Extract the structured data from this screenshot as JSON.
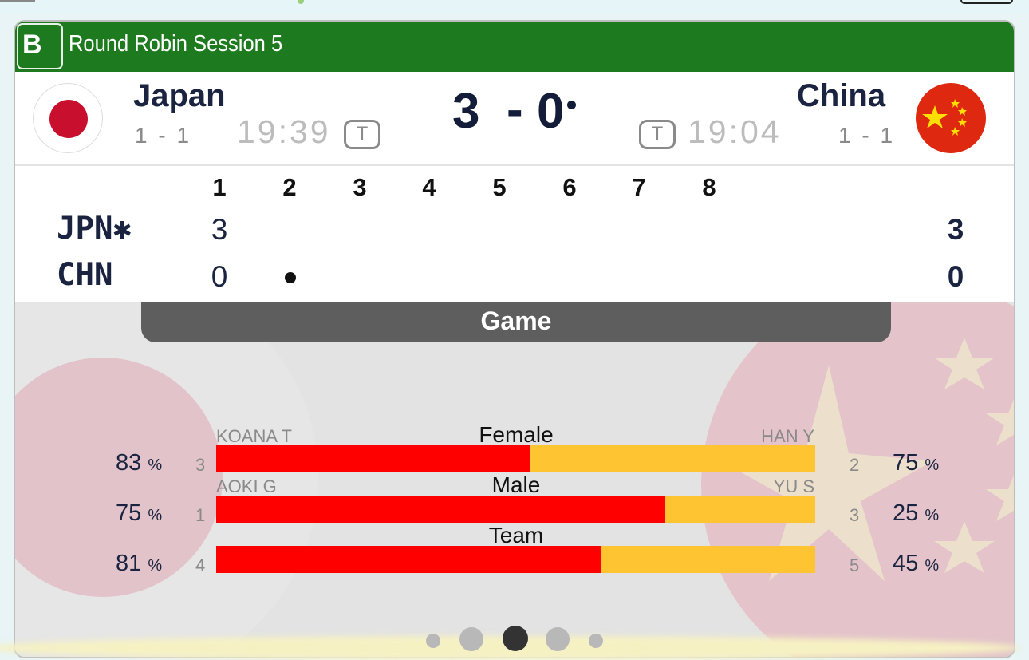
{
  "header": {
    "badge": "B",
    "session_title": "Round Robin Session 5"
  },
  "home": {
    "name": "Japan",
    "abbr": "JPN",
    "hammer_mark": "✱",
    "record": "1 - 1",
    "clock": "19:39",
    "timeout_label": "T",
    "score": "3",
    "flag": "japan-flag-icon"
  },
  "away": {
    "name": "China",
    "abbr": "CHN",
    "record": "1 - 1",
    "clock": "19:04",
    "timeout_label": "T",
    "score": "0",
    "flag": "china-flag-icon"
  },
  "score_separator": "-",
  "linescore": {
    "ends": [
      "1",
      "2",
      "3",
      "4",
      "5",
      "6",
      "7",
      "8"
    ],
    "home_ends": [
      "3"
    ],
    "away_ends": [
      "0"
    ],
    "home_total": "3",
    "away_total": "0"
  },
  "stats": {
    "tab_label": "Game",
    "rows": [
      {
        "label": "Female",
        "home_player": "KOANA T",
        "away_player": "HAN Y",
        "home_count": "3",
        "away_count": "2",
        "home_pct": "83",
        "away_pct": "75",
        "pct_unit": "%",
        "home_share": 0.525
      },
      {
        "label": "Male",
        "home_player": "AOKI G",
        "away_player": "YU S",
        "home_count": "1",
        "away_count": "3",
        "home_pct": "75",
        "away_pct": "25",
        "pct_unit": "%",
        "home_share": 0.75
      },
      {
        "label": "Team",
        "home_player": "",
        "away_player": "",
        "home_count": "4",
        "away_count": "5",
        "home_pct": "81",
        "away_pct": "45",
        "pct_unit": "%",
        "home_share": 0.643
      }
    ]
  },
  "pager": {
    "pages": 5,
    "active": 2
  },
  "colors": {
    "header_green": "#1e7a1e",
    "home_bar": "#ff0000",
    "away_bar": "#ffc431",
    "navy": "#1a2440"
  }
}
